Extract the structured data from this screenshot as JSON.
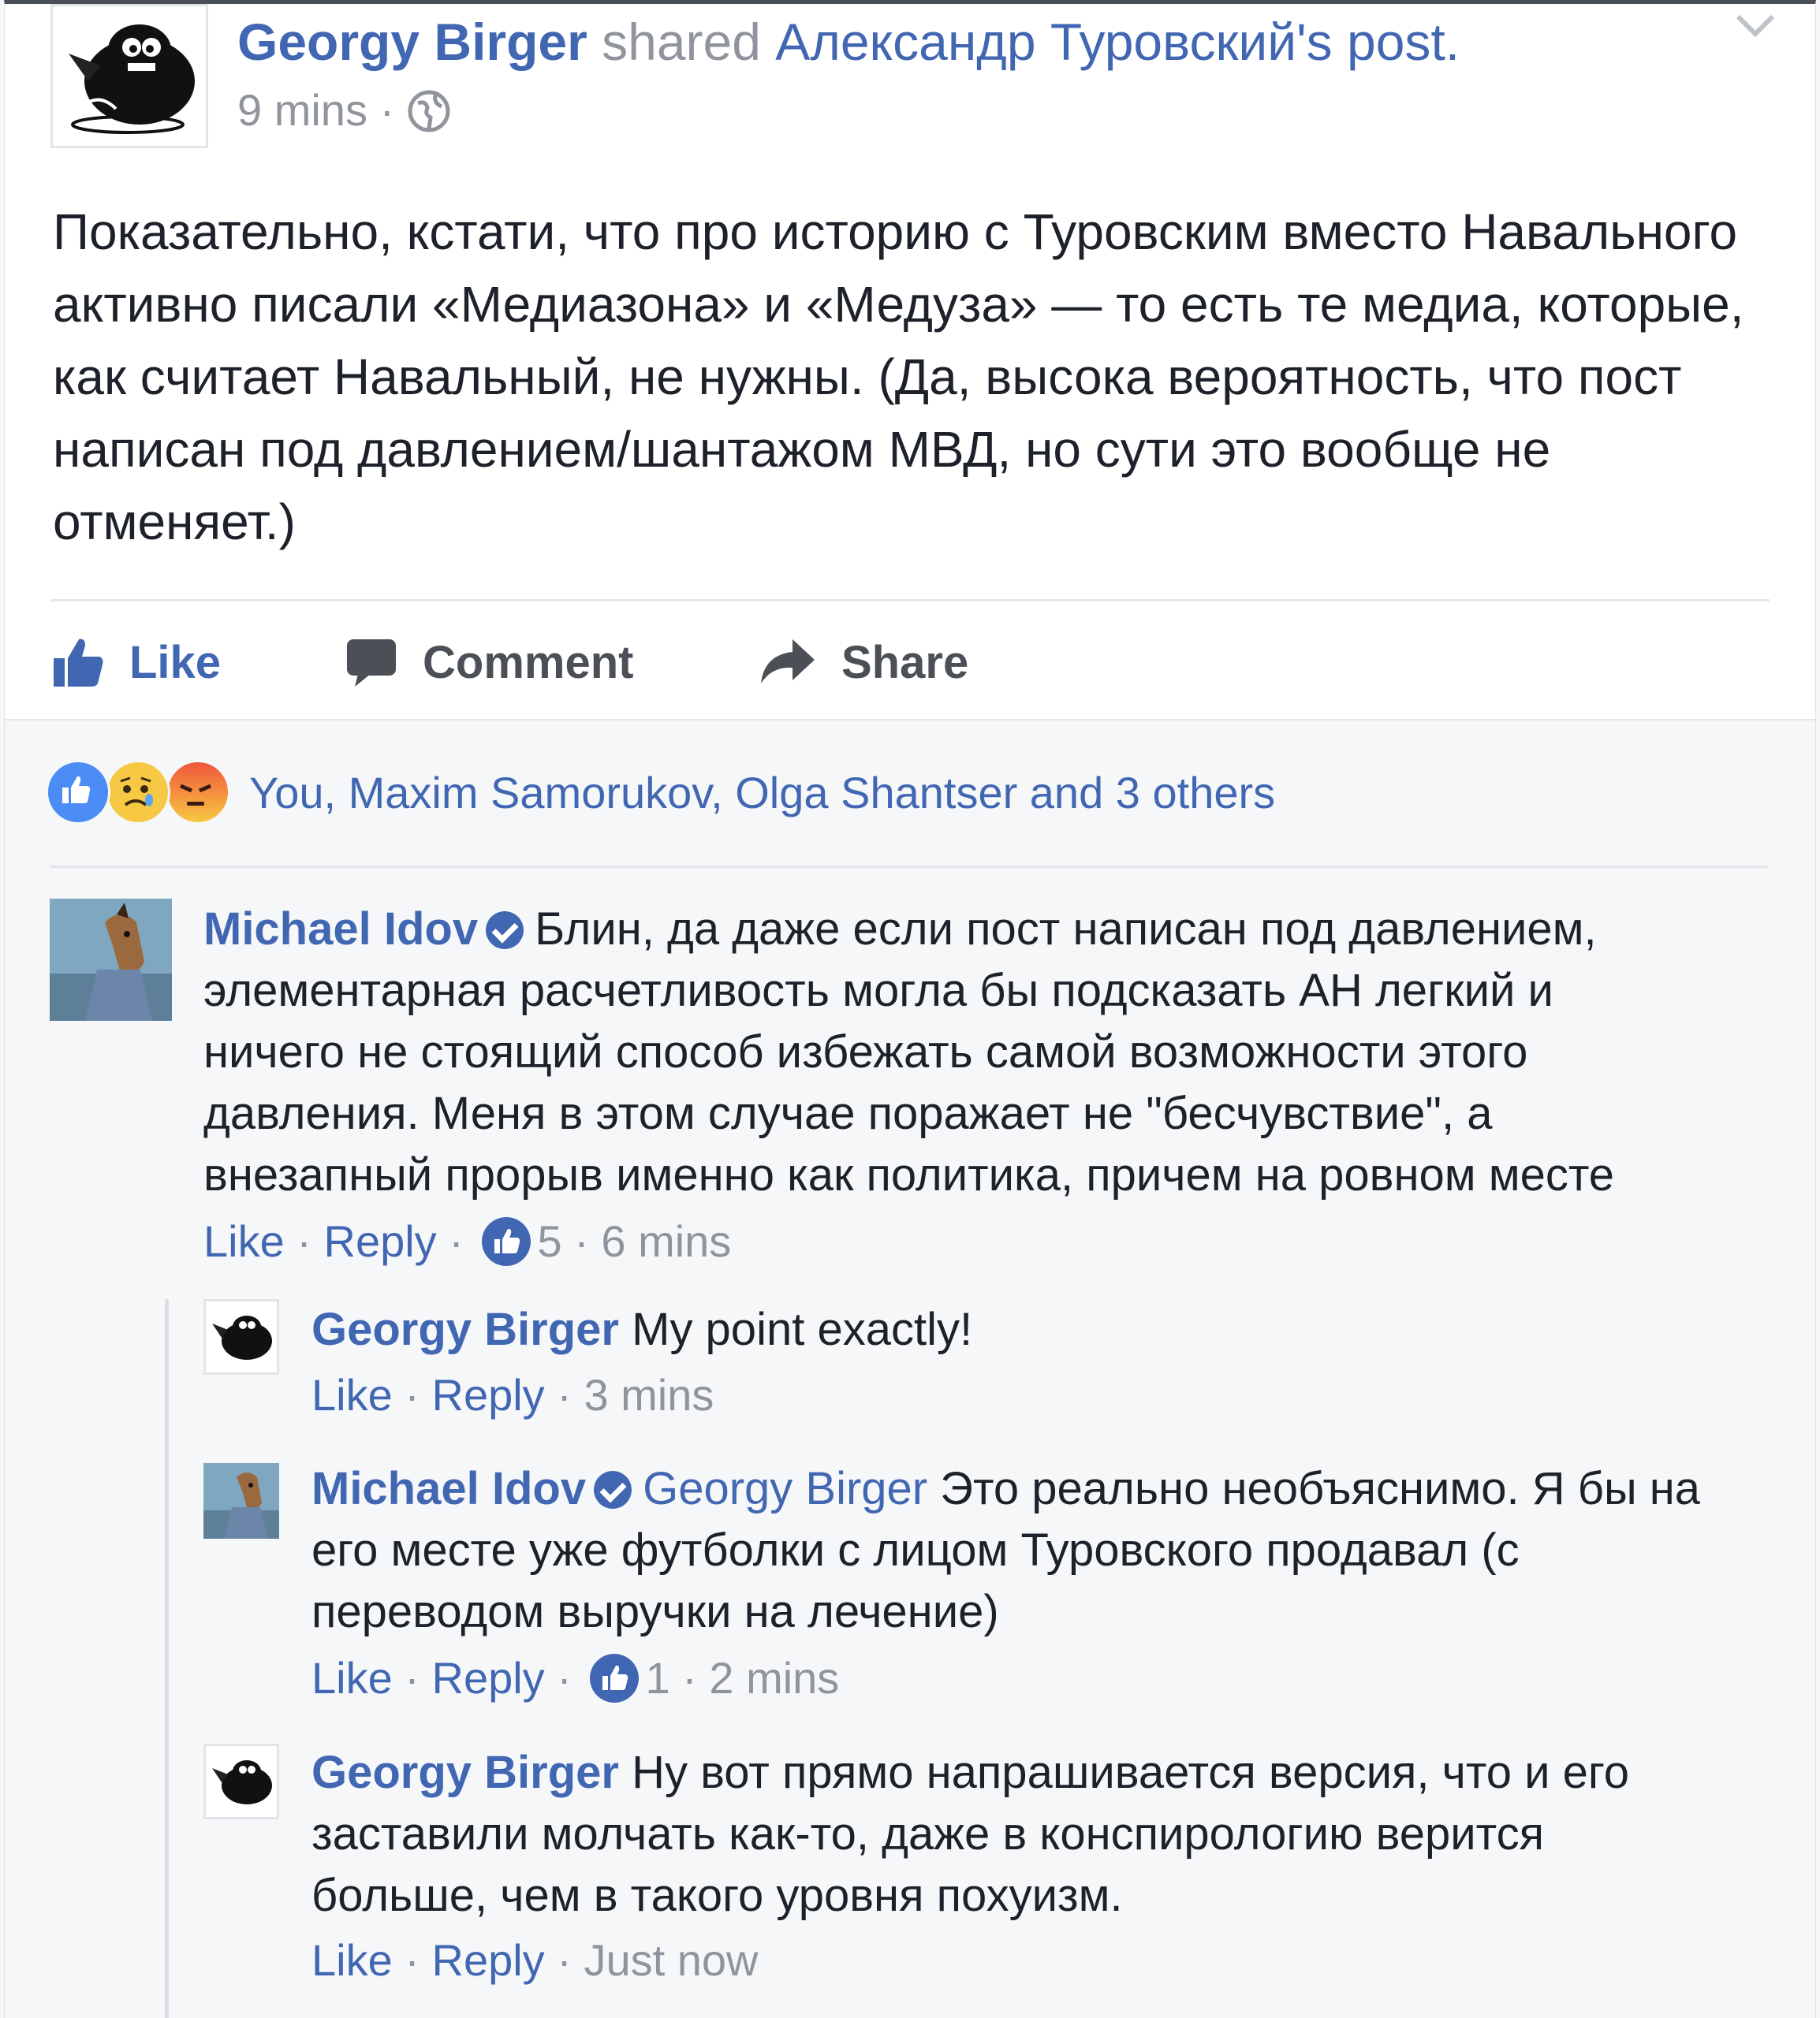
{
  "post": {
    "author": "Georgy Birger",
    "shared_word": "shared",
    "original_author": "Александр Туровский's",
    "post_word": "post.",
    "time": "9 mins",
    "separator": "·",
    "privacy_icon": "globe-icon",
    "text": "Показательно, кстати, что про историю с Туровским вместо Навального активно писали «Медиазона» и «Медуза» — то есть те медиа, которые, как считает Навальный, не нужны. (Да, высока вероятность, что пост написан под давлением/шантажом МВД, но сути это вообще не отменяет.)"
  },
  "actions": {
    "like": "Like",
    "comment": "Comment",
    "share": "Share"
  },
  "reactions": {
    "icons": [
      "like-reaction-icon",
      "sad-reaction-icon",
      "angry-reaction-icon"
    ],
    "summary": "You, Maxim Samorukov, Olga Shantser and 3 others"
  },
  "comments": [
    {
      "author": "Michael Idov",
      "verified": true,
      "text": "Блин, да даже если пост написан под давлением, элементарная расчетливость могла бы подсказать АН легкий и ничего не стоящий способ избежать самой возможности этого давления. Меня в этом случае поражает не \"бесчувствие\", а внезапный прорыв именно как политика, причем на ровном месте",
      "like": "Like",
      "reply": "Reply",
      "likes": "5",
      "time": "6 mins"
    }
  ],
  "replies": [
    {
      "author": "Georgy Birger",
      "text": "My point exactly!",
      "like": "Like",
      "reply": "Reply",
      "time": "3 mins"
    },
    {
      "author": "Michael Idov",
      "verified": true,
      "mention": "Georgy Birger",
      "text": "Это реально необъяснимо. Я бы на его месте уже футболки с лицом Туровского продавал (с переводом выручки на лечение)",
      "like": "Like",
      "reply": "Reply",
      "likes": "1",
      "time": "2 mins"
    },
    {
      "author": "Georgy Birger",
      "text": "Ну вот прямо напрашивается версия, что и его заставили молчать как-то, даже в конспирологию верится больше, чем в такого уровня похуизм.",
      "like": "Like",
      "reply": "Reply",
      "time": "Just now"
    }
  ],
  "colors": {
    "link": "#4267b2",
    "meta": "#90949c",
    "text": "#1d2129",
    "background": "#f6f7f9",
    "angry": "#f0563b",
    "sad": "#f7c843"
  }
}
